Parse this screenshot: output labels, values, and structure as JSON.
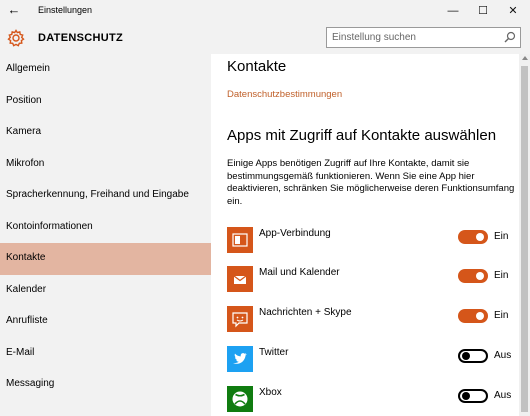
{
  "window": {
    "title": "Einstellungen",
    "back_glyph": "←",
    "minimize_glyph": "—",
    "maximize_glyph": "☐",
    "close_glyph": "✕"
  },
  "header": {
    "icon": "gear-icon",
    "title": "DATENSCHUTZ",
    "search_placeholder": "Einstellung suchen"
  },
  "sidebar": {
    "items": [
      {
        "label": "Allgemein",
        "active": false
      },
      {
        "label": "Position",
        "active": false
      },
      {
        "label": "Kamera",
        "active": false
      },
      {
        "label": "Mikrofon",
        "active": false
      },
      {
        "label": "Spracherkennung, Freihand und Eingabe",
        "active": false
      },
      {
        "label": "Kontoinformationen",
        "active": false
      },
      {
        "label": "Kontakte",
        "active": true
      },
      {
        "label": "Kalender",
        "active": false
      },
      {
        "label": "Anrufliste",
        "active": false
      },
      {
        "label": "E-Mail",
        "active": false
      },
      {
        "label": "Messaging",
        "active": false
      }
    ]
  },
  "main": {
    "title": "Kontakte",
    "privacy_link": "Datenschutzbestimmungen",
    "apps_heading": "Apps mit Zugriff auf Kontakte auswählen",
    "description": "Einige Apps benötigen Zugriff auf Ihre Kontakte, damit sie bestimmungsgemäß funktionieren. Wenn Sie eine App hier deaktivieren, schränken Sie möglicherweise deren Funktionsumfang ein.",
    "apps": [
      {
        "name": "App-Verbindung",
        "state": "Ein",
        "on": true,
        "icon": "app-connector-icon",
        "tile_color": "#d5561a"
      },
      {
        "name": "Mail und Kalender",
        "state": "Ein",
        "on": true,
        "icon": "mail-icon",
        "tile_color": "#d5561a"
      },
      {
        "name": "Nachrichten + Skype",
        "state": "Ein",
        "on": true,
        "icon": "messaging-icon",
        "tile_color": "#d5561a"
      },
      {
        "name": "Twitter",
        "state": "Aus",
        "on": false,
        "icon": "twitter-icon",
        "tile_color": "#1da1f2"
      },
      {
        "name": "Xbox",
        "state": "Aus",
        "on": false,
        "icon": "xbox-icon",
        "tile_color": "#107c10"
      }
    ]
  },
  "colors": {
    "accent": "#d5561a",
    "sidebar_active": "#e3b5a1",
    "link": "#c0602a",
    "chrome_bg": "#f2f2f2"
  }
}
